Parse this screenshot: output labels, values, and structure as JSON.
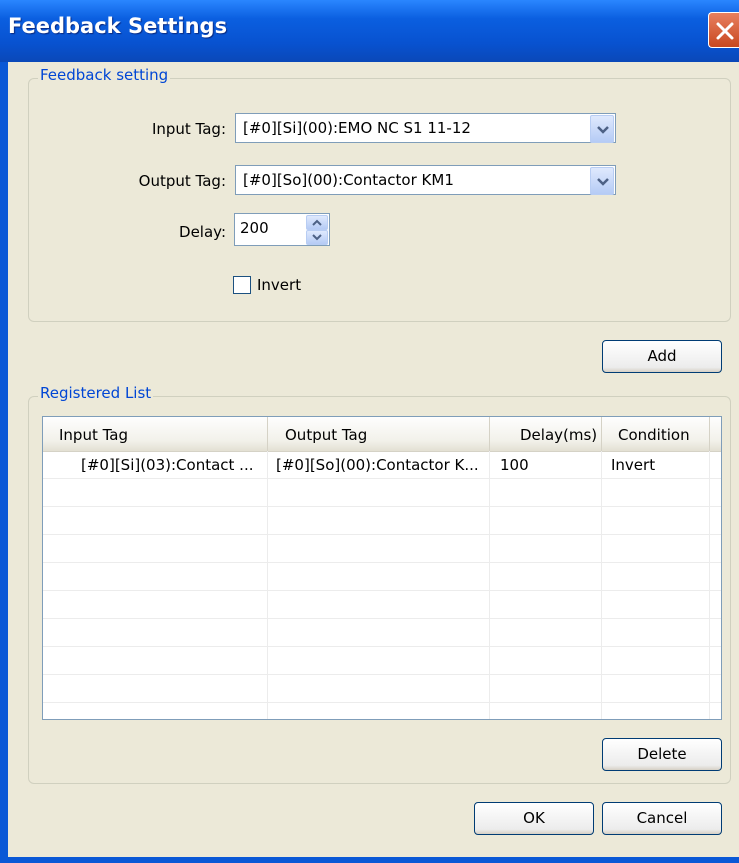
{
  "window": {
    "title": "Feedback Settings"
  },
  "feedback_group": {
    "label": "Feedback setting",
    "input_tag_label": "Input Tag:",
    "input_tag_value": "[#0][Si](00):EMO NC S1 11-12",
    "output_tag_label": "Output Tag:",
    "output_tag_value": "[#0][So](00):Contactor KM1",
    "delay_label": "Delay:",
    "delay_value": "200",
    "invert_label": "Invert",
    "invert_checked": false
  },
  "buttons": {
    "add": "Add",
    "delete": "Delete",
    "ok": "OK",
    "cancel": "Cancel"
  },
  "registered_group": {
    "label": "Registered List",
    "columns": [
      "Input Tag",
      "Output Tag",
      "Delay(ms)",
      "Condition"
    ],
    "rows": [
      {
        "input_tag": "[#0][Si](03):Contact ...",
        "output_tag": "[#0][So](00):Contactor K...",
        "delay": "100",
        "condition": "Invert"
      }
    ]
  },
  "icons": {
    "close": "close-icon",
    "dropdown": "chevron-down-icon",
    "spin_up": "spin-up-icon",
    "spin_down": "spin-down-icon"
  },
  "colors": {
    "title_bar": "#0a58d6",
    "group_label": "#0046d5",
    "dialog_bg": "#ece9d8",
    "close_button": "#d85a30"
  }
}
